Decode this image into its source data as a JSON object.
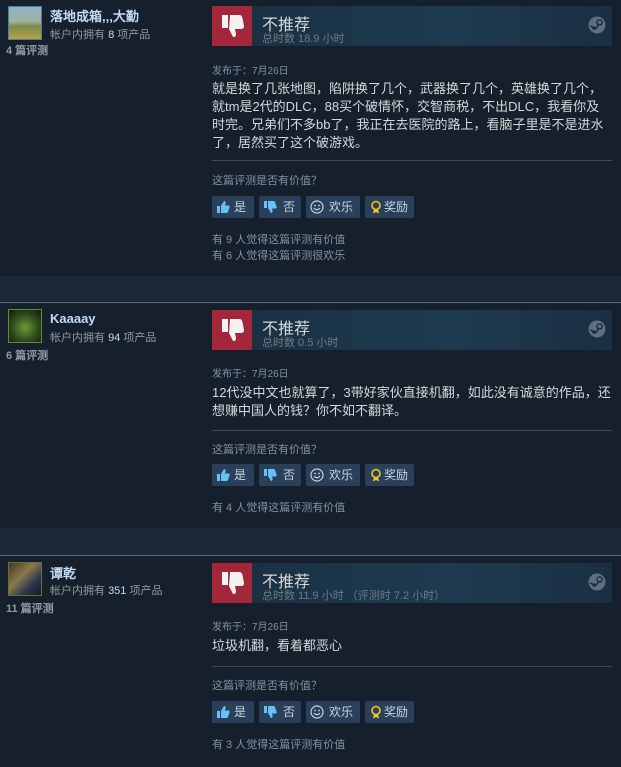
{
  "reviews": [
    {
      "username": "落地成箱,,,大勤",
      "owned_prefix": "帐户内拥有",
      "owned_count": "8",
      "owned_suffix": "项产品",
      "review_count": "4 篇评测",
      "verdict": "不推荐",
      "hours": "总时数 18.9 小时",
      "posted": "发布于：7月26日",
      "content": "就是换了几张地图，陷阱换了几个，武器换了几个，英雄换了几个，就tm是2代的DLC，88买个破情怀，交智商税，不出DLC，我看你及时完。兄弟们不多bb了，我正在去医院的路上，看脑子里是不是进水了，居然买了这个破游戏。",
      "helpful_question": "这篇评测是否有价值？",
      "buttons": {
        "yes": "是",
        "no": "否",
        "funny": "欢乐",
        "award": "奖励"
      },
      "helpful_counts": [
        "有 9 人觉得这篇评测有价值",
        "有 6 人觉得这篇评测很欢乐"
      ]
    },
    {
      "username": "Kaaaay",
      "owned_prefix": "帐户内拥有",
      "owned_count": "94",
      "owned_suffix": "项产品",
      "review_count": "6 篇评测",
      "verdict": "不推荐",
      "hours": "总时数 0.5 小时",
      "posted": "发布于：7月26日",
      "content": "12代没中文也就算了，3带好家伙直接机翻，如此没有诚意的作品，还想赚中国人的钱？你不如不翻译。",
      "helpful_question": "这篇评测是否有价值？",
      "buttons": {
        "yes": "是",
        "no": "否",
        "funny": "欢乐",
        "award": "奖励"
      },
      "helpful_counts": [
        "有 4 人觉得这篇评测有价值"
      ]
    },
    {
      "username": "谭乾",
      "owned_prefix": "帐户内拥有",
      "owned_count": "351",
      "owned_suffix": "项产品",
      "review_count": "11 篇评测",
      "verdict": "不推荐",
      "hours": "总时数 11.9 小时 （评测时 7.2 小时）",
      "posted": "发布于：7月26日",
      "content": "垃圾机翻，看着都恶心",
      "helpful_question": "这篇评测是否有价值？",
      "buttons": {
        "yes": "是",
        "no": "否",
        "funny": "欢乐",
        "award": "奖励"
      },
      "helpful_counts": [
        "有 3 人觉得这篇评测有价值"
      ]
    }
  ],
  "icons": {
    "thumbs_down": "thumbs-down-icon",
    "steam": "steam-logo-icon",
    "thumbs_up_small": "thumbs-up-icon",
    "thumbs_down_small": "thumbs-down-small-icon",
    "smiley": "smiley-icon",
    "award": "award-icon"
  },
  "colors": {
    "background": "#1b2838",
    "thumb_down_box": "#a3263b",
    "button_bg": "#2a3f5a",
    "username": "#c1dbf4"
  }
}
